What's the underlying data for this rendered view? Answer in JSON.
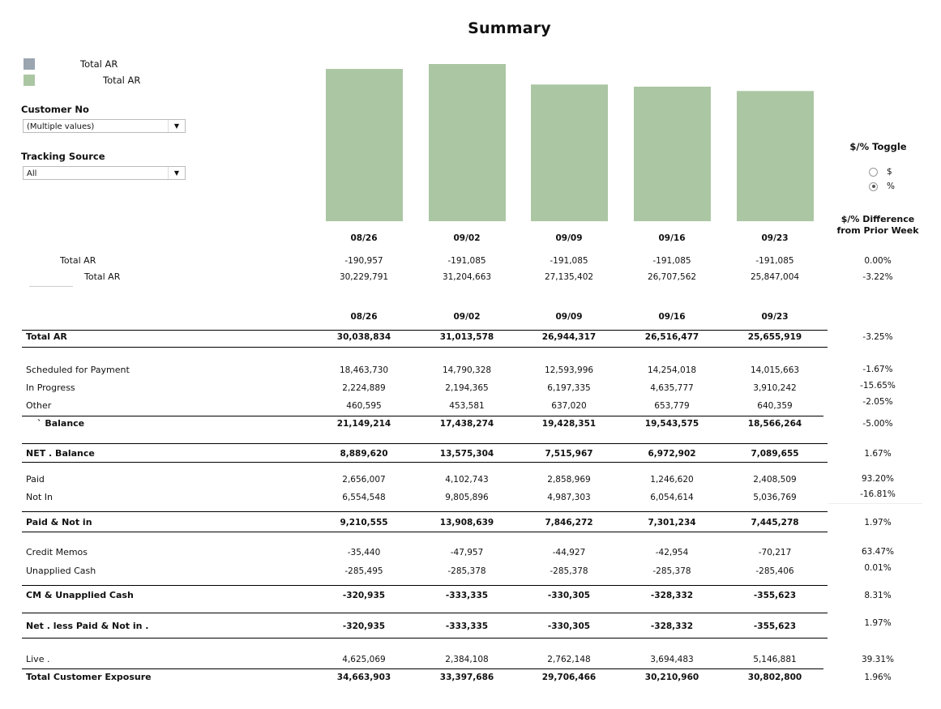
{
  "title": "Summary",
  "legend": [
    {
      "label": "Total AR",
      "color": "#9aa5b0"
    },
    {
      "label": "Total AR",
      "color": "#abc6a3"
    }
  ],
  "filters": {
    "customer": {
      "label": "Customer No",
      "value": "(Multiple values)"
    },
    "tracking": {
      "label": "Tracking Source",
      "value": "All"
    }
  },
  "toggle": {
    "title": "$/% Toggle",
    "options": [
      "$",
      "%"
    ],
    "selected": "%"
  },
  "diff_title": "$/% Difference from Prior Week",
  "weeks": [
    "08/26",
    "09/02",
    "09/09",
    "09/16",
    "09/23"
  ],
  "top_rows": [
    {
      "label": "Total AR",
      "values": [
        "-190,957",
        "-191,085",
        "-191,085",
        "-191,085",
        "-191,085"
      ],
      "pct": "0.00%"
    },
    {
      "label": "Total AR",
      "values": [
        "30,229,791",
        "31,204,663",
        "27,135,402",
        "26,707,562",
        "25,847,004"
      ],
      "pct": "-3.22%"
    }
  ],
  "chart_data": {
    "type": "bar",
    "categories": [
      "08/26",
      "09/02",
      "09/09",
      "09/16",
      "09/23"
    ],
    "series": [
      {
        "name": "Total AR",
        "values": [
          30229791,
          31204663,
          27135402,
          26707562,
          25847004
        ],
        "color": "#abc6a3"
      }
    ]
  },
  "table_rows": [
    {
      "label": "Total AR",
      "bold": true,
      "values": [
        "30,038,834",
        "31,013,578",
        "26,944,317",
        "26,516,477",
        "25,655,919"
      ],
      "pct": "-3.25%"
    },
    {
      "label": "Scheduled for Payment",
      "bold": false,
      "values": [
        "18,463,730",
        "14,790,328",
        "12,593,996",
        "14,254,018",
        "14,015,663"
      ],
      "pct": "-1.67%"
    },
    {
      "label": "In Progress",
      "bold": false,
      "values": [
        "2,224,889",
        "2,194,365",
        "6,197,335",
        "4,635,777",
        "3,910,242"
      ],
      "pct": "-15.65%"
    },
    {
      "label": "Other",
      "bold": false,
      "values": [
        "460,595",
        "453,581",
        "637,020",
        "653,779",
        "640,359"
      ],
      "pct": "-2.05%"
    },
    {
      "label": "` Balance",
      "bold": true,
      "values": [
        "21,149,214",
        "17,438,274",
        "19,428,351",
        "19,543,575",
        "18,566,264"
      ],
      "pct": "-5.00%"
    },
    {
      "label": "NET .   Balance",
      "bold": true,
      "values": [
        "8,889,620",
        "13,575,304",
        "7,515,967",
        "6,972,902",
        "7,089,655"
      ],
      "pct": "1.67%"
    },
    {
      "label": "Paid",
      "bold": false,
      "values": [
        "2,656,007",
        "4,102,743",
        "2,858,969",
        "1,246,620",
        "2,408,509"
      ],
      "pct": "93.20%"
    },
    {
      "label": "Not In",
      "bold": false,
      "values": [
        "6,554,548",
        "9,805,896",
        "4,987,303",
        "6,054,614",
        "5,036,769"
      ],
      "pct": "-16.81%"
    },
    {
      "label": "Paid & Not in",
      "bold": true,
      "values": [
        "9,210,555",
        "13,908,639",
        "7,846,272",
        "7,301,234",
        "7,445,278"
      ],
      "pct": "1.97%"
    },
    {
      "label": "Credit Memos",
      "bold": false,
      "values": [
        "-35,440",
        "-47,957",
        "-44,927",
        "-42,954",
        "-70,217"
      ],
      "pct": "63.47%"
    },
    {
      "label": "Unapplied Cash",
      "bold": false,
      "values": [
        "-285,495",
        "-285,378",
        "-285,378",
        "-285,378",
        "-285,406"
      ],
      "pct": "0.01%"
    },
    {
      "label": "CM & Unapplied Cash",
      "bold": true,
      "values": [
        "-320,935",
        "-333,335",
        "-330,305",
        "-328,332",
        "-355,623"
      ],
      "pct": "8.31%"
    },
    {
      "label": "Net .   less Paid & Not in .",
      "bold": true,
      "values": [
        "-320,935",
        "-333,335",
        "-330,305",
        "-328,332",
        "-355,623"
      ],
      "pct": "1.97%"
    },
    {
      "label": "Live .",
      "bold": false,
      "values": [
        "4,625,069",
        "2,384,108",
        "2,762,148",
        "3,694,483",
        "5,146,881"
      ],
      "pct": "39.31%"
    },
    {
      "label": "Total Customer Exposure",
      "bold": true,
      "values": [
        "34,663,903",
        "33,397,686",
        "29,706,466",
        "30,210,960",
        "30,802,800"
      ],
      "pct": "1.96%"
    }
  ]
}
